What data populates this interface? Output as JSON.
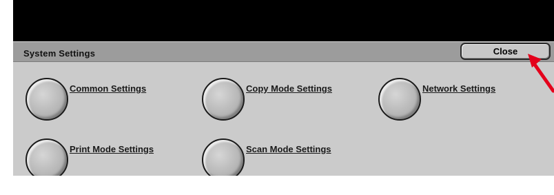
{
  "window": {
    "title": "System Settings"
  },
  "toolbar": {
    "close_label": "Close"
  },
  "options": [
    {
      "label": "Common Settings"
    },
    {
      "label": "Copy Mode Settings"
    },
    {
      "label": "Network Settings"
    },
    {
      "label": "Print Mode Settings"
    },
    {
      "label": "Scan Mode Settings"
    }
  ],
  "annotation": {
    "arrow_icon": "red-arrow-icon",
    "arrow_color": "#e4001b"
  },
  "colors": {
    "panel_background": "#cbcbcb",
    "title_bar": "#9c9c9c",
    "screen_header": "#000000"
  }
}
